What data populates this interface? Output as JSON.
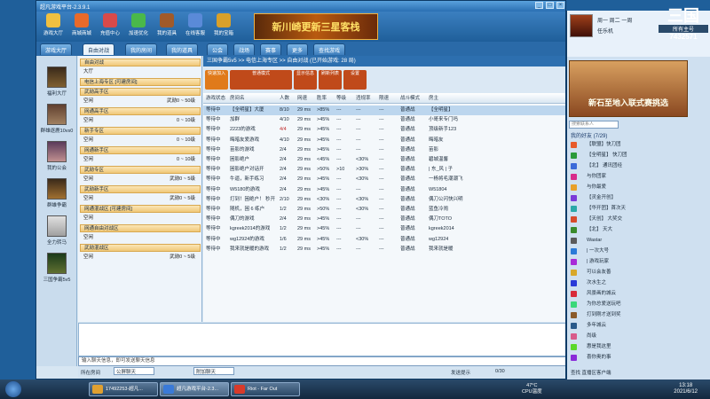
{
  "window": {
    "title": "超凡游戏平台-2.3.9.1"
  },
  "toolbar": {
    "buttons": [
      "游戏大厅",
      "商城商城",
      "充值中心",
      "加速优化",
      "我的道具",
      "在线客服",
      "我的宝箱"
    ],
    "banner_text": "新川崎更新三星客栈"
  },
  "tabs": [
    "游戏大厅",
    "自由对战",
    "我的房间",
    "我的道具",
    "公会",
    "战场",
    "赛事",
    "更多",
    "查找游戏"
  ],
  "left_panel": [
    "福利大厅",
    "群雄逐鹿10vs0",
    "我的公会",
    "群雄争霸",
    "全力转马",
    "三国争霸5v5"
  ],
  "zones": [
    {
      "label": "自由对战",
      "type": "head"
    },
    {
      "label": "大厅",
      "type": "sub"
    },
    {
      "label": "电信上海专区 [可建房间]",
      "type": "head"
    },
    {
      "label": "武勋高手区",
      "type": "head"
    },
    {
      "label": "空闲",
      "type": "sub",
      "right": "武勋0 ~ 50级"
    },
    {
      "label": "网通高手区",
      "type": "head"
    },
    {
      "label": "空闲",
      "type": "sub",
      "right": "0 ~ 10级"
    },
    {
      "label": "新手专区",
      "type": "head"
    },
    {
      "label": "空闲",
      "type": "sub",
      "right": "0 ~ 10级"
    },
    {
      "label": "网通新手区",
      "type": "head"
    },
    {
      "label": "空闲",
      "type": "sub",
      "right": "0 ~ 10级"
    },
    {
      "label": "武勋专区",
      "type": "head"
    },
    {
      "label": "空闲",
      "type": "sub",
      "right": "武勋0 ~ 5级"
    },
    {
      "label": "武勋新手区",
      "type": "head"
    },
    {
      "label": "空闲",
      "type": "sub",
      "right": "武勋0 ~ 5级"
    },
    {
      "label": "网通混战区 [可建房间]",
      "type": "head"
    },
    {
      "label": "空闲",
      "type": "sub"
    },
    {
      "label": "网通自由对战区",
      "type": "head"
    },
    {
      "label": "空闲",
      "type": "sub"
    },
    {
      "label": "武勋混战区",
      "type": "head"
    },
    {
      "label": "空闲",
      "type": "sub",
      "right": "武勋0 ~ 5级"
    }
  ],
  "main": {
    "path": "三国争霸5v5 >> 电信上海专区 >> 自由对战 (已开始游戏: 28 局)",
    "actions": [
      "快速加入",
      "普通模式",
      "显示信息",
      "刷新列表",
      "设置"
    ],
    "columns": [
      "游戏状态",
      "房间名",
      "人数",
      "网速",
      "胜率",
      "等级",
      "违规率",
      "限速",
      "战斗模式",
      "房主"
    ],
    "rows": [
      [
        "等待中",
        "【全明星】大厦",
        "8/10",
        "29 ms",
        ">85%",
        "---",
        "---",
        "---",
        "普通战",
        "【全明星】"
      ],
      [
        "等待中",
        "加群",
        "4/10",
        "29 ms",
        ">45%",
        "---",
        "---",
        "---",
        "普通战",
        "小哥来专门吗"
      ],
      [
        "等待中",
        "2223的游戏",
        "4/4",
        "29 ms",
        ">45%",
        "---",
        "---",
        "---",
        "普通战",
        "顶级新手123"
      ],
      [
        "等待中",
        "晦暗友爱游戏",
        "4/10",
        "29 ms",
        ">45%",
        "---",
        "---",
        "---",
        "普通战",
        "晦暗友"
      ],
      [
        "等待中",
        "苗影的游戏",
        "2/4",
        "29 ms",
        ">45%",
        "---",
        "---",
        "---",
        "普通战",
        "苗影"
      ],
      [
        "等待中",
        "困影绝户",
        "2/4",
        "29 ms",
        "<45%",
        "---",
        "<30%",
        "---",
        "普通战",
        "碧城温馨"
      ],
      [
        "等待中",
        "困影绝户对话开",
        "2/4",
        "29 ms",
        ">50%",
        ">10",
        ">30%",
        "---",
        "普通战",
        "| 东_风 | 子"
      ],
      [
        "等待中",
        "牛逼，新手练习",
        "2/4",
        "29 ms",
        ">45%",
        "---",
        "<30%",
        "---",
        "普通战",
        "一杨将毛潮潮飞"
      ],
      [
        "等待中",
        "W5180的游戏",
        "2/4",
        "29 ms",
        ">45%",
        "---",
        "---",
        "---",
        "普通战",
        "W51804"
      ],
      [
        "等待中",
        "打到！困绝户！ 秒开",
        "2/10",
        "29 ms",
        "<30%",
        "---",
        "<30%",
        "---",
        "普通战",
        "偶刀公闪快兴明"
      ],
      [
        "等待中",
        "随机，困 6 练户",
        "1/2",
        "29 ms",
        ">50%",
        "---",
        "<30%",
        "---",
        "普通战",
        "蓝鱼冷闹"
      ],
      [
        "等待中",
        "偶刀的游戏",
        "2/4",
        "29 ms",
        ">45%",
        "---",
        "---",
        "---",
        "普通战",
        "偶刀TOTO"
      ],
      [
        "等待中",
        "kgreek2014的游戏",
        "1/2",
        "29 ms",
        ">45%",
        "---",
        "---",
        "---",
        "普通战",
        "kgreek2014"
      ],
      [
        "等待中",
        "wg12924的游戏",
        "1/6",
        "29 ms",
        ">45%",
        "---",
        "<30%",
        "---",
        "普通战",
        "wg12924"
      ],
      [
        "等待中",
        "我来就是暖的游戏",
        "1/2",
        "29 ms",
        ">45%",
        "---",
        "---",
        "---",
        "普通战",
        "我来就是暖"
      ]
    ]
  },
  "chat": {
    "input_placeholder": "输入聊天信息，即可发送聊天信息"
  },
  "status": {
    "channel": "所在房间",
    "chat": "公屏聊天",
    "hint": "附加聊天",
    "vote": "发送提示",
    "page": "0/30"
  },
  "right_panel": {
    "username": "周一 周二 一周",
    "level": "任乐机",
    "ad_text": "新石至地入联式赛挑选",
    "search_placeholder": "搜索联系人",
    "friends_header": "我的好友 (7/29)",
    "friends": [
      "【联盟】快刀团",
      "【全明星】 快刀团",
      "【北】 通讯团经",
      "与你团家",
      "与你最爱",
      "【灵金开创】",
      "【华开团】首次天",
      "【天创】 大奖交",
      "【北】 天大",
      "Wastar",
      "| 一次大号",
      "| 游戏玩家",
      "可以会友善",
      "次水生之",
      "风景画的城云",
      "为你总爱送玩吧",
      "打到刚才送到奖",
      "多年城云",
      "尚级",
      "惠是我这里",
      "喜你奥的事"
    ],
    "friend_colors": [
      "#e85a2a",
      "#2a9a3a",
      "#3a6ad8",
      "#d82a8a",
      "#e8a02a",
      "#7a3ad8",
      "#2aa8a8",
      "#d84a2a",
      "#3a8a2a",
      "#5a5a5a",
      "#2a7ad8",
      "#a82ad8",
      "#d8a82a",
      "#2a3ad8",
      "#d82a3a",
      "#3ad87a",
      "#8a5a2a",
      "#2a5a8a",
      "#d85a8a",
      "#5ad82a",
      "#8a2ad8"
    ],
    "id_label": "所有主号",
    "id_number": "7432571",
    "bottom_text": "查找 直播区客户端"
  },
  "taskbar": {
    "tasks": [
      "17492253-超凡...",
      "超凡游戏平台-2.3...",
      "Riot - Far Out"
    ],
    "temp": "47°C",
    "temp_label": "CPU温度",
    "time": "13:18",
    "date": "2021/6/12"
  }
}
